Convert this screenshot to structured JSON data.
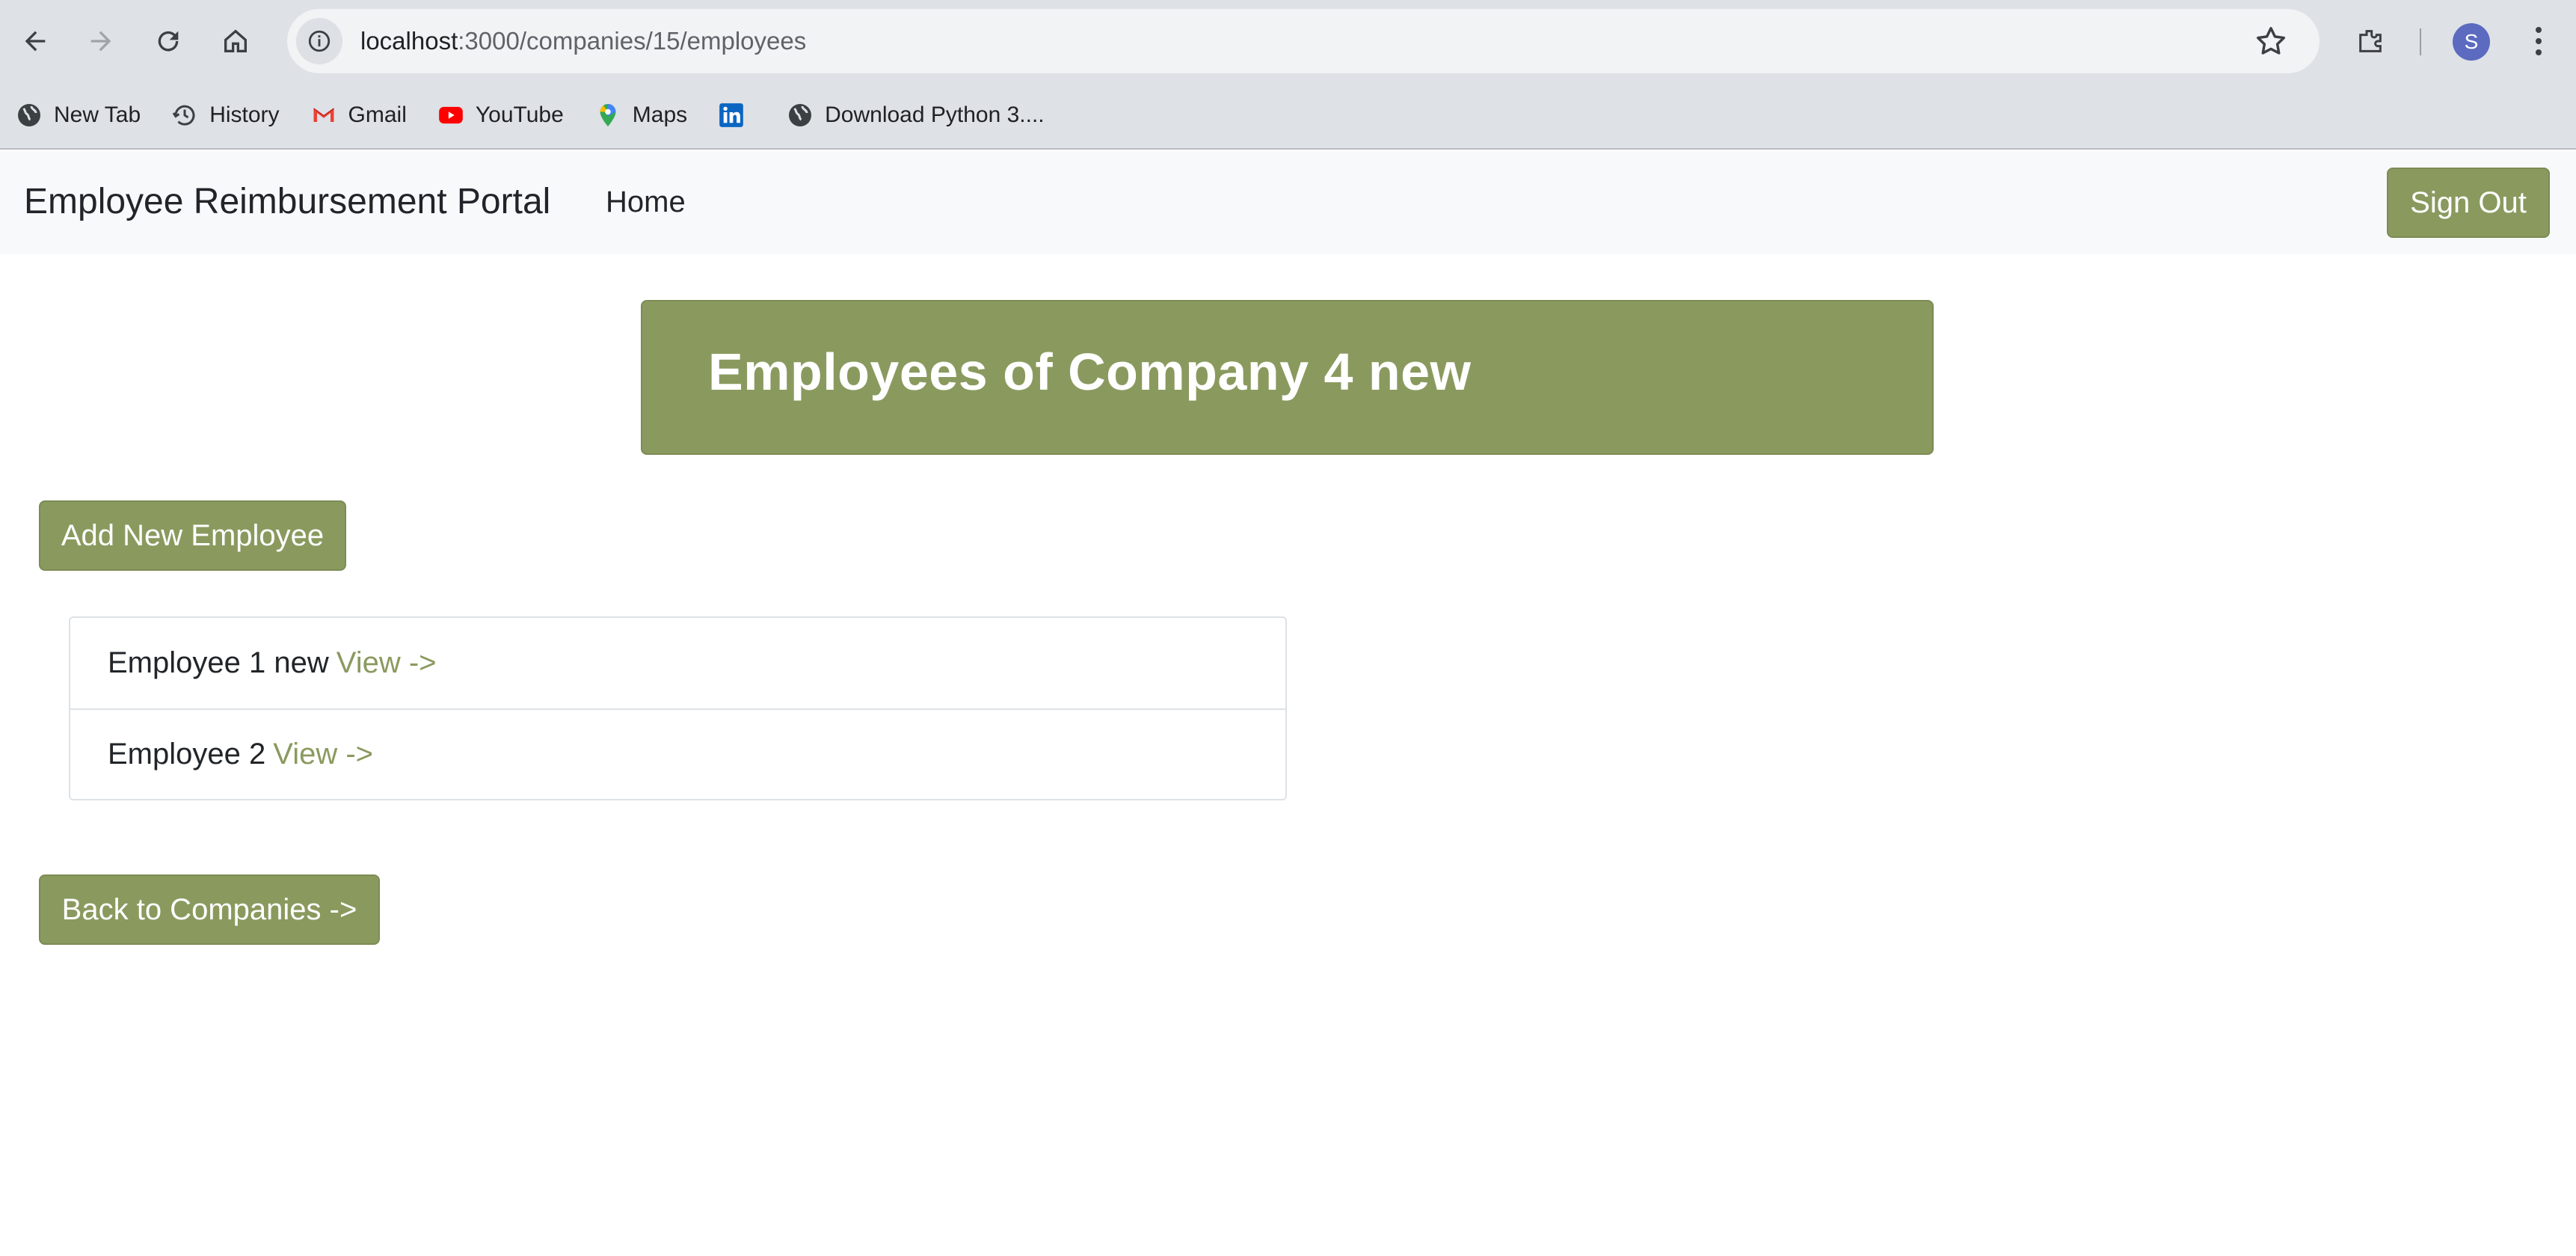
{
  "browser": {
    "url_host": "localhost",
    "url_path": ":3000/companies/15/employees",
    "profile_initial": "S",
    "bookmarks": [
      {
        "label": "New Tab",
        "icon": "globe-icon"
      },
      {
        "label": "History",
        "icon": "history-icon"
      },
      {
        "label": "Gmail",
        "icon": "gmail-icon"
      },
      {
        "label": "YouTube",
        "icon": "youtube-icon"
      },
      {
        "label": "Maps",
        "icon": "maps-icon"
      },
      {
        "label": "",
        "icon": "linkedin-icon"
      },
      {
        "label": "Download Python 3....",
        "icon": "globe-icon"
      }
    ]
  },
  "navbar": {
    "brand": "Employee Reimbursement Portal",
    "home": "Home",
    "signout": "Sign Out"
  },
  "page": {
    "title": "Employees of Company 4 new",
    "add_button": "Add New Employee",
    "back_button": "Back to Companies ->",
    "employees": [
      {
        "name": "Employee 1 new",
        "link": "View ->"
      },
      {
        "name": "Employee 2",
        "link": "View ->"
      }
    ]
  },
  "colors": {
    "accent": "#8a9a5f",
    "navbar_bg": "#f8f9fa",
    "chrome_bg": "#dee1e6"
  }
}
